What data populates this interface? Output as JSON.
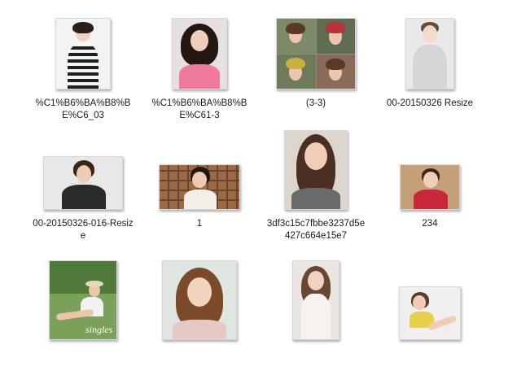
{
  "files": [
    {
      "label": "%C1%B6%BA%B8%BE%C6_03",
      "bg": "#f3f3f3",
      "hair": "#2b2018",
      "skin": "#f0d2c0",
      "outfit": "#1e1e24"
    },
    {
      "label": "%C1%B6%BA%B8%BE%C61-3",
      "bg": "#e6e1de",
      "hair": "#231712",
      "skin": "#efcdb9",
      "outfit": "#f07a9c"
    },
    {
      "label": "(3-3)",
      "bg": "#8a8f7a",
      "hair": "#5a3a26",
      "skin": "#ecc7ae",
      "outfit": "#c9b040"
    },
    {
      "label": "00-20150326 Resize",
      "bg": "#e9e9e9",
      "hair": "#6a4a38",
      "skin": "#f2dace",
      "outfit": "#d6d6d6"
    },
    {
      "label": "00-20150326-016-Resize",
      "bg": "#e8e8e8",
      "hair": "#3a2619",
      "skin": "#efcbb3",
      "outfit": "#2a2a2a"
    },
    {
      "label": "1",
      "bg": "#9b6a45",
      "hair": "#1f1712",
      "skin": "#eecab4",
      "outfit": "#f3eee8"
    },
    {
      "label": "3df3c15c7fbbe3237d5e427c664e15e7",
      "bg": "#dcd6cf",
      "hair": "#4a2f22",
      "skin": "#f0cdb5",
      "outfit": "#6a6a6a"
    },
    {
      "label": "234",
      "bg": "#c59f78",
      "hair": "#3a241a",
      "skin": "#f0cfb8",
      "outfit": "#c8263b"
    },
    {
      "label": "",
      "bg": "#7aa05a",
      "hair": "#5a3d2a",
      "skin": "#ecc6aa",
      "outfit": "#f2f2f2"
    },
    {
      "label": "",
      "bg": "#dfe6e2",
      "hair": "#7a4a2a",
      "skin": "#f2d3be",
      "outfit": "#e6c9c4"
    },
    {
      "label": "",
      "bg": "#ece6e2",
      "hair": "#6a4634",
      "skin": "#f1d2c0",
      "outfit": "#f5f2f0"
    },
    {
      "label": "",
      "bg": "#f1efee",
      "hair": "#5a3a2a",
      "skin": "#f0ccb4",
      "outfit": "#e8d14a"
    }
  ],
  "watermark_text": "singles"
}
